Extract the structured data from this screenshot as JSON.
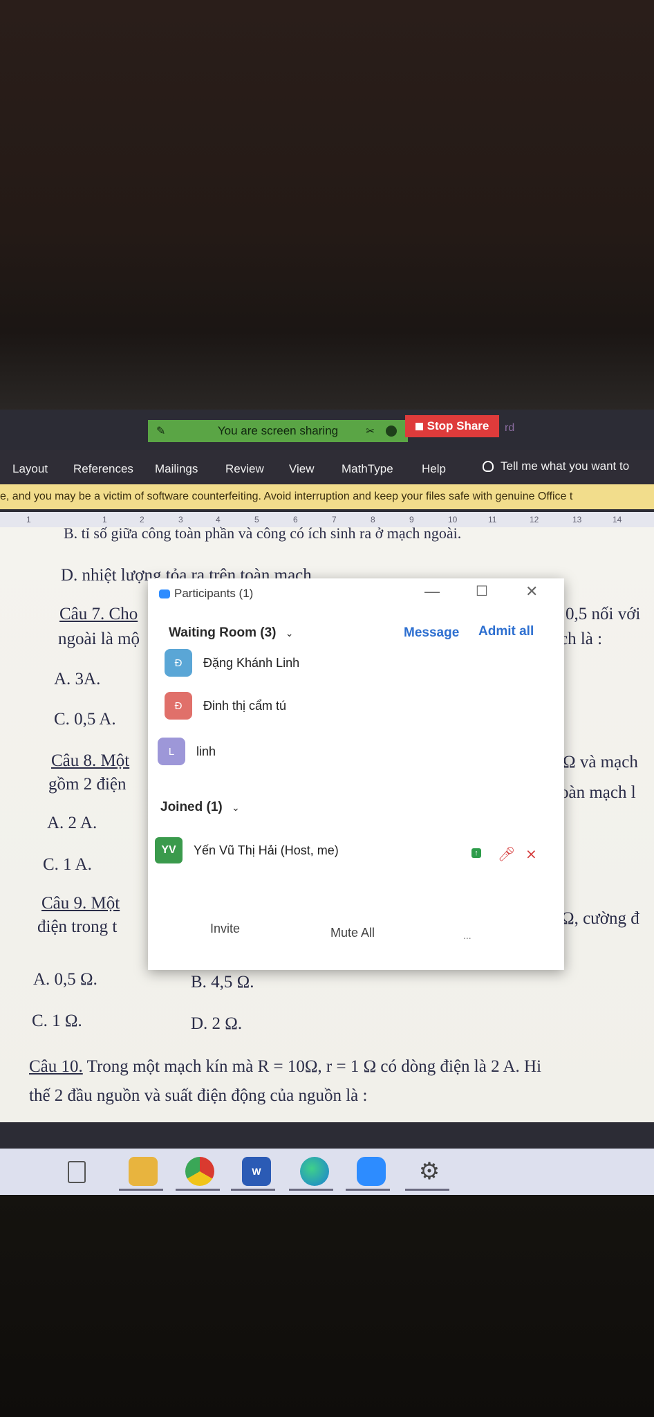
{
  "share_bar": {
    "sharing_text": "You are screen sharing",
    "stop_label": "Stop Share",
    "fragment": "rd"
  },
  "ribbon": {
    "tabs": [
      "Layout",
      "References",
      "Mailings",
      "Review",
      "View",
      "MathType",
      "Help"
    ],
    "tell_me": "Tell me what you want to"
  },
  "notice": "e, and you may be a victim of software counterfeiting. Avoid interruption and keep your files safe with genuine Office t",
  "ruler": [
    "1",
    "1",
    "2",
    "3",
    "4",
    "5",
    "6",
    "7",
    "8",
    "9",
    "10",
    "11",
    "12",
    "13",
    "14"
  ],
  "document": {
    "line_b": "B. tỉ số giữa công toàn phần và công có ích sinh ra ở mạch ngoài.",
    "line_d": "D. nhiệt lượng tỏa ra trên toàn mạch",
    "q7_left": "Câu 7. Cho",
    "q7_right": "0,5 nối với",
    "q7_line2_left": "ngoài là mộ",
    "q7_line2_right": "ch là :",
    "q7_a": "A. 3A.",
    "q7_c": "C. 0,5 A.",
    "q8_left": "Câu 8. Một",
    "q8_right": "Ω và mạch",
    "q8_line2_left": "gồm 2 điện",
    "q8_line2_right": "oàn mạch l",
    "q8_a": "A. 2 A.",
    "q8_c": "C. 1 A.",
    "q9_left": "Câu 9. Một",
    "q9_line2_left": "điện trong t",
    "q9_right": "Ω, cường đ",
    "q9_a": "A. 0,5 Ω.",
    "q9_b": "B. 4,5 Ω.",
    "q9_c": "C. 1 Ω.",
    "q9_d": "D. 2 Ω.",
    "q10_label": "Câu 10.",
    "q10_text": " Trong một mạch kín mà R = 10Ω, r = 1 Ω có dòng điện là 2 A. Hi",
    "q10_line2": "thế 2 đầu nguồn và suất điện động của nguồn là :"
  },
  "participants": {
    "title": "Participants (1)",
    "waiting_header": "Waiting Room (3)",
    "message_label": "Message",
    "admit_all_label": "Admit all",
    "waiting": [
      {
        "initial": "Đ",
        "name": "Đặng Khánh Linh",
        "color": "#5aa6d6"
      },
      {
        "initial": "Đ",
        "name": "Đinh thị cẩm tú",
        "color": "#e0706a"
      },
      {
        "initial": "L",
        "name": "linh",
        "color": "#9d97d8"
      }
    ],
    "joined_header": "Joined (1)",
    "host": {
      "initials": "YV",
      "name": "Yến Vũ Thị Hải (Host, me)"
    },
    "invite_label": "Invite",
    "mute_all_label": "Mute All",
    "more_label": "..."
  },
  "taskbar_icons": [
    "task-view-icon",
    "file-explorer-icon",
    "chrome-icon",
    "word-icon",
    "edge-icon",
    "zoom-icon",
    "settings-icon"
  ]
}
